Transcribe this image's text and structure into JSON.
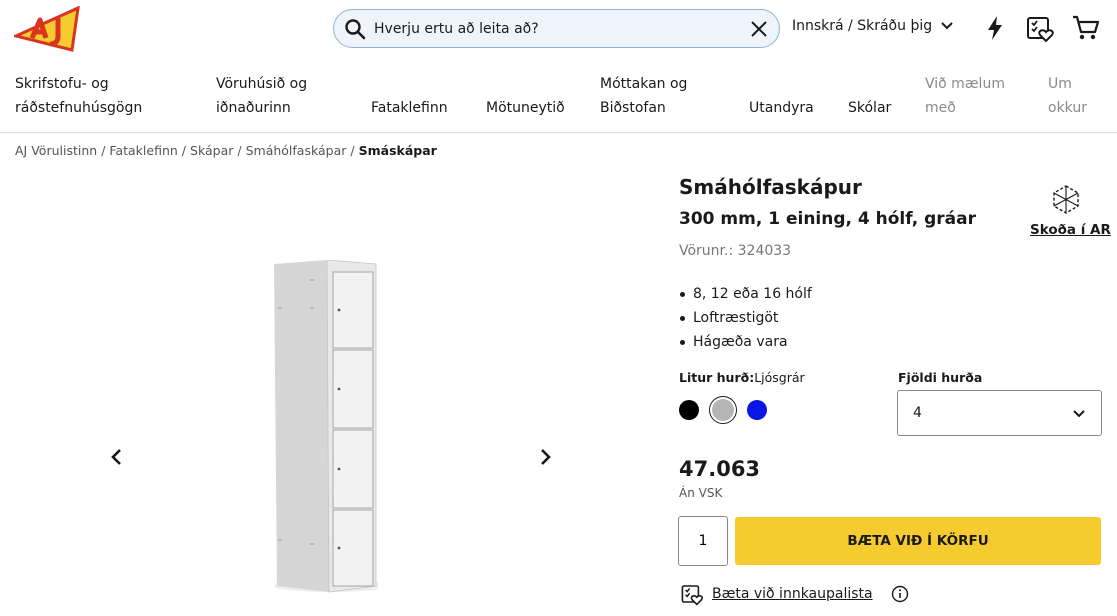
{
  "header": {
    "search_placeholder": "Hverju ertu að leita að?",
    "login_label": "Innskrá / Skráðu þig"
  },
  "nav": {
    "items": [
      {
        "line1": "Skrifstofu- og",
        "line2": "ráðstefnuhúsgögn"
      },
      {
        "line1": "Vöruhúsið og",
        "line2": "iðnaðurinn"
      },
      {
        "line1": "",
        "line2": "Fataklefinn"
      },
      {
        "line1": "",
        "line2": "Mötuneytið"
      },
      {
        "line1": "Móttakan og",
        "line2": "Biðstofan"
      },
      {
        "line1": "",
        "line2": "Utandyra"
      },
      {
        "line1": "",
        "line2": "Skólar"
      },
      {
        "line1": "Við mælum",
        "line2": "með"
      },
      {
        "line1": "Um",
        "line2": "okkur"
      }
    ]
  },
  "breadcrumb": [
    "AJ Vörulistinn",
    "Fataklefinn",
    "Skápar",
    "Smáhólfaskápar",
    "Smáskápar"
  ],
  "product": {
    "title": "Smáhólfaskápur",
    "subtitle": "300 mm, 1 eining, 4 hólf, gráar",
    "sku": "Vörunr.: 324033",
    "ar_label": "Skoða í AR",
    "features": [
      "8, 12 eða 16 hólf",
      "Loftræstigöt",
      "Hágæða vara"
    ],
    "color_label": "Litur hurð:",
    "color_value": "Ljósgrár",
    "colors": [
      "#000000",
      "#b5b5b5",
      "#0a16e8"
    ],
    "qty_label": "Fjöldi hurða",
    "qty_value": "4",
    "price": "47.063",
    "vat_note": "Án VSK",
    "cart_qty": "1",
    "add_to_cart": "BÆTA VIÐ Í KÖRFU",
    "wishlist_label": "Bæta við innkaupalista"
  },
  "colors": {
    "accent": "#f6cb2f",
    "search_bg": "#eef4fa"
  }
}
